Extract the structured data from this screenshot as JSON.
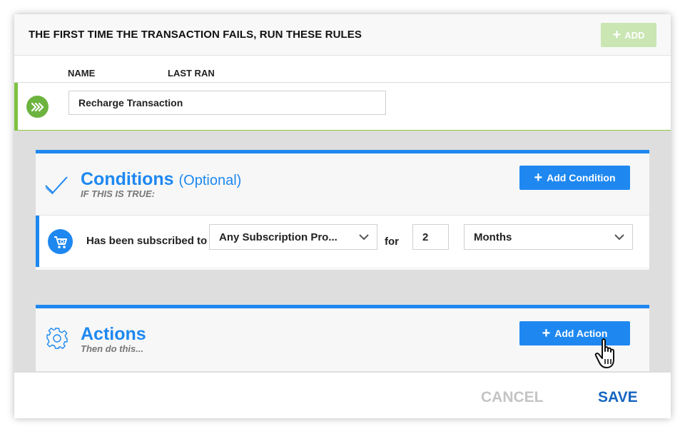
{
  "header": {
    "title": "THE FIRST TIME THE TRANSACTION FAILS, RUN THESE RULES",
    "add_label": "ADD"
  },
  "columns": {
    "name": "NAME",
    "last_ran": "LAST RAN"
  },
  "rule": {
    "name_value": "Recharge Transaction"
  },
  "conditions": {
    "title": "Conditions",
    "optional": "(Optional)",
    "subtitle": "IF THIS IS TRUE:",
    "add_button": "Add Condition",
    "row": {
      "label": "Has been subscribed to",
      "product_select": "Any Subscription Pro...",
      "for_label": "for",
      "quantity": "2",
      "unit_select": "Months"
    }
  },
  "actions": {
    "title": "Actions",
    "subtitle": "Then do this...",
    "add_button": "Add Action"
  },
  "footer": {
    "cancel": "CANCEL",
    "save": "SAVE"
  },
  "colors": {
    "accent_blue": "#1e88f0",
    "accent_green": "#7fc241",
    "disabled_green": "#c9e6b3",
    "save_blue": "#1565c0",
    "cancel_grey": "#c4c4c4"
  },
  "icons": {
    "rule": "chevrons-right-icon",
    "conditions": "checkmark-icon",
    "condition_row": "cart-icon",
    "actions": "gear-icon",
    "cursor": "hand-pointer-icon"
  }
}
